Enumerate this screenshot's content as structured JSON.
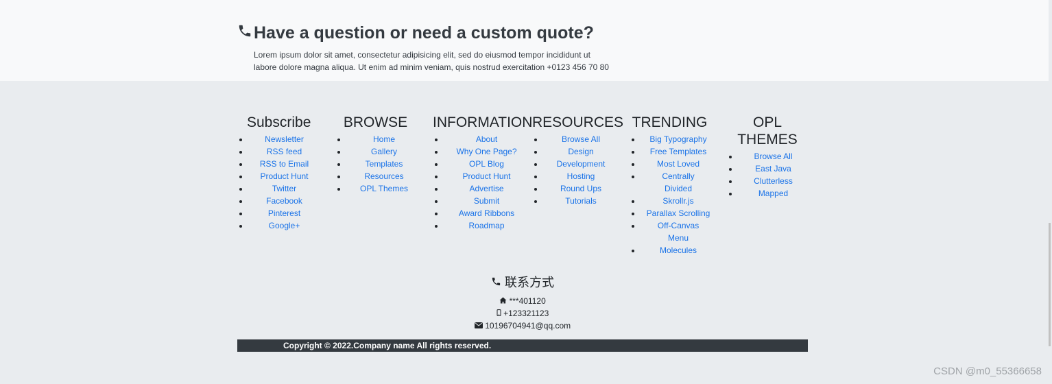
{
  "quote": {
    "title": "Have a question or need a custom quote?",
    "text_line1": "Lorem ipsum dolor sit amet, consectetur adipisicing elit, sed do eiusmod tempor incididunt ut",
    "text_line2": "labore dolore magna aliqua. Ut enim ad minim veniam, quis nostrud exercitation +0123 456 70 80"
  },
  "columns": [
    {
      "title": "Subscribe",
      "items": [
        "Newsletter",
        "RSS feed",
        "RSS to Email",
        "Product Hunt",
        "Twitter",
        "Facebook",
        "Pinterest",
        "Google+"
      ]
    },
    {
      "title": "BROWSE",
      "items": [
        "Home",
        "Gallery",
        "Templates",
        "Resources",
        "OPL Themes"
      ]
    },
    {
      "title": "INFORMATION",
      "items": [
        "About",
        "Why One Page?",
        "OPL Blog",
        "Product Hunt",
        "Advertise",
        "Submit",
        "Award Ribbons",
        "Roadmap"
      ]
    },
    {
      "title": "RESOURCES",
      "items": [
        "Browse All",
        "Design",
        "Development",
        "Hosting",
        "Round Ups",
        "Tutorials"
      ]
    },
    {
      "title": "TRENDING",
      "items": [
        "Big Typography",
        "Free Templates",
        "Most Loved",
        "Centrally Divided",
        "Skrollr.js",
        "Parallax Scrolling",
        "Off-Canvas Menu",
        "Molecules"
      ]
    },
    {
      "title": "OPL THEMES",
      "items": [
        "Browse All",
        "East Java",
        "Clutterless",
        "Mapped"
      ]
    }
  ],
  "contact": {
    "title": "联系方式",
    "address": "***401120",
    "phone": "+123321123",
    "email": "10196704941@qq.com"
  },
  "copyright": "Copyright © 2022.Company name All rights reserved.",
  "watermark": "CSDN @m0_55366658"
}
